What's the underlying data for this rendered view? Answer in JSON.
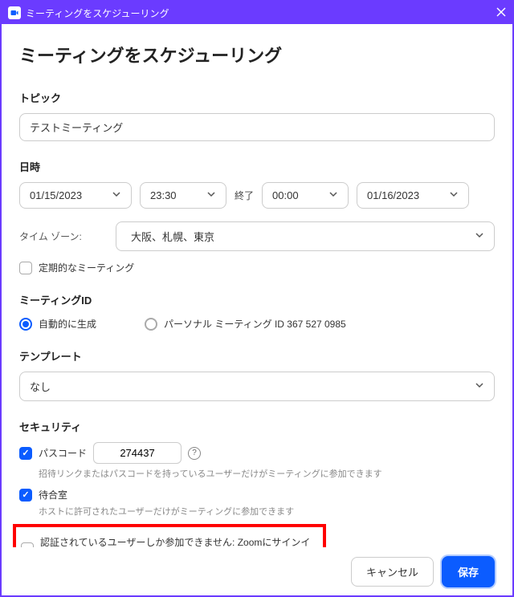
{
  "titlebar": {
    "title": "ミーティングをスケジューリング"
  },
  "page": {
    "title": "ミーティングをスケジューリング"
  },
  "topic": {
    "label": "トピック",
    "value": "テストミーティング"
  },
  "datetime": {
    "label": "日時",
    "start_date": "01/15/2023",
    "start_time": "23:30",
    "end_label": "終了",
    "end_time": "00:00",
    "end_date": "01/16/2023"
  },
  "timezone": {
    "label": "タイム ゾーン:",
    "value": "大阪、札幌、東京"
  },
  "recurring": {
    "label": "定期的なミーティング",
    "checked": false
  },
  "meeting_id": {
    "label": "ミーティングID",
    "auto": {
      "label": "自動的に生成",
      "checked": true
    },
    "personal": {
      "label": "パーソナル ミーティング ID 367 527 0985",
      "checked": false
    }
  },
  "template": {
    "label": "テンプレート",
    "value": "なし"
  },
  "security": {
    "label": "セキュリティ",
    "passcode": {
      "label": "パスコード",
      "checked": true,
      "value": "274437",
      "hint": "招待リンクまたはパスコードを持っているユーザーだけがミーティングに参加できます"
    },
    "waiting_room": {
      "label": "待合室",
      "checked": true,
      "hint": "ホストに許可されたユーザーだけがミーティングに参加できます"
    },
    "auth_only": {
      "label": "認証されているユーザーしか参加できません: Zoomにサインイン",
      "checked": false
    }
  },
  "footer": {
    "cancel": "キャンセル",
    "save": "保存"
  }
}
